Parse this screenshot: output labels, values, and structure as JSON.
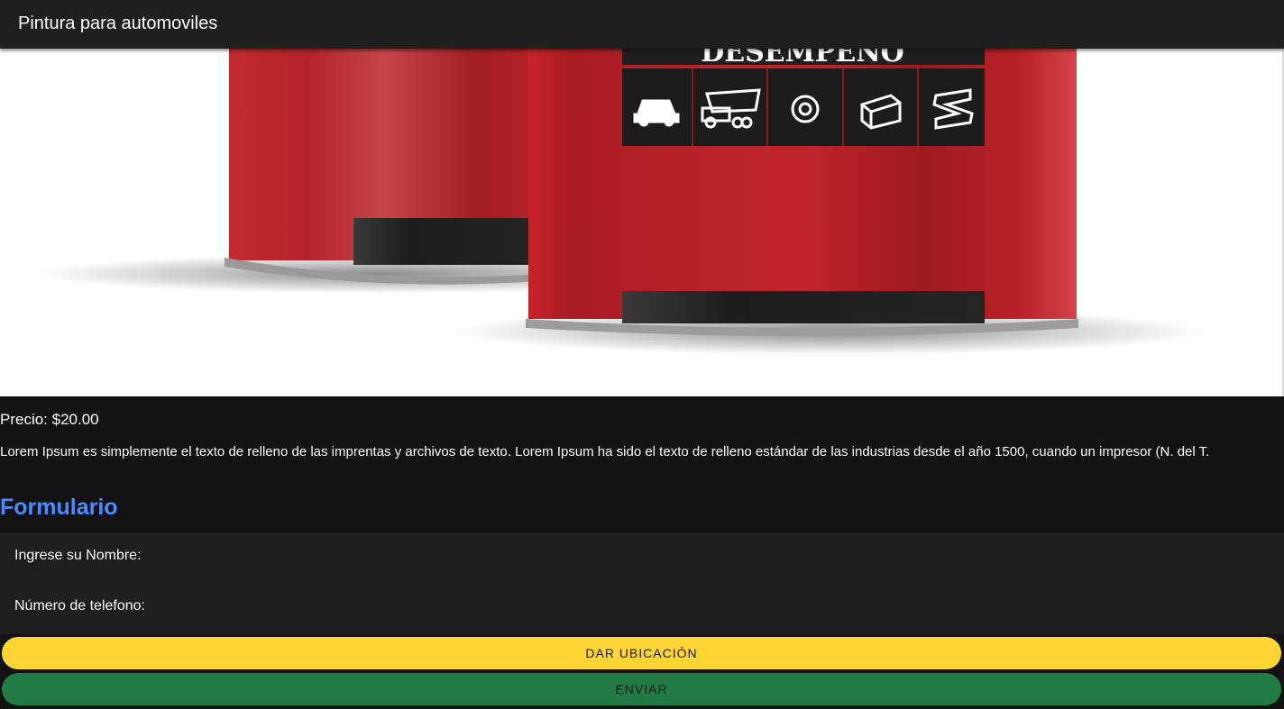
{
  "toolbar": {
    "title": "Pintura para automoviles"
  },
  "hero": {
    "image_alt": "Latas de pintura roja",
    "label_text": "DESEMPEÑO"
  },
  "product": {
    "price": "Precio: $20.00",
    "description": "Lorem Ipsum es simplemente el texto de relleno de las imprentas y archivos de texto. Lorem Ipsum ha sido el texto de relleno estándar de las industrias desde el año 1500, cuando un impresor (N. del T."
  },
  "form": {
    "title": "Formulario",
    "name_label": "Ingrese su Nombre:",
    "name_value": "",
    "phone_label": "Número de telefono:",
    "phone_value": "",
    "location_button": "DAR UBICACIÓN",
    "submit_button": "ENVIAR"
  },
  "colors": {
    "toolbar_bg": "#1f1f1f",
    "page_bg": "#121212",
    "form_title": "#4a8cff",
    "location_button": "#fdd534",
    "submit_button": "#227a45",
    "can_red": "#b01e24"
  }
}
